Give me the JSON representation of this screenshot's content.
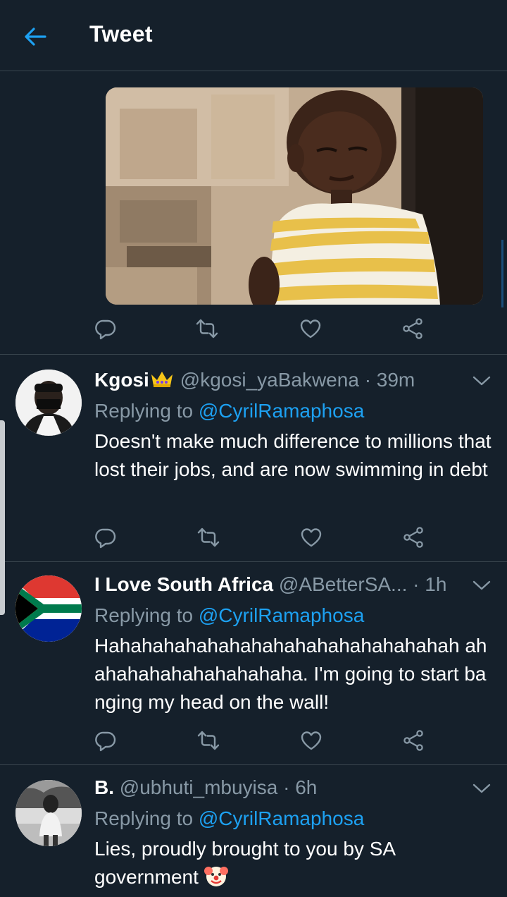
{
  "header": {
    "title": "Tweet"
  },
  "icons": {
    "back": "arrow-left-icon",
    "reply": "comment-icon",
    "retweet": "retweet-icon",
    "like": "heart-icon",
    "share": "share-icon",
    "more": "chevron-down-icon"
  },
  "colors": {
    "background": "#15202b",
    "accent": "#1da1f2",
    "muted": "#8899a6",
    "divider": "#38444d"
  },
  "replies": [
    {
      "display_name": "Kgosi",
      "handle": "@kgosi_yaBakwena",
      "time": "· 39m",
      "replying_prefix": "Replying to",
      "replying_to": "@CyrilRamaphosa",
      "text": "Doesn't make much difference to millions that lost their jobs, and are now swimming in debt"
    },
    {
      "display_name": "I Love South Africa",
      "handle": "@ABetterSA...",
      "time": "· 1h",
      "replying_prefix": "Replying to",
      "replying_to": "@CyrilRamaphosa",
      "text": "Hahahahahahahahahahahahahahahahah ahahahahahahahahahaha. I'm going to start banging my head on the wall!"
    },
    {
      "display_name": "B.",
      "handle": "@ubhuti_mbuyisa",
      "time": "· 6h",
      "replying_prefix": "Replying to",
      "replying_to": "@CyrilRamaphosa",
      "text": "Lies, proudly brought to you by SA government"
    }
  ]
}
